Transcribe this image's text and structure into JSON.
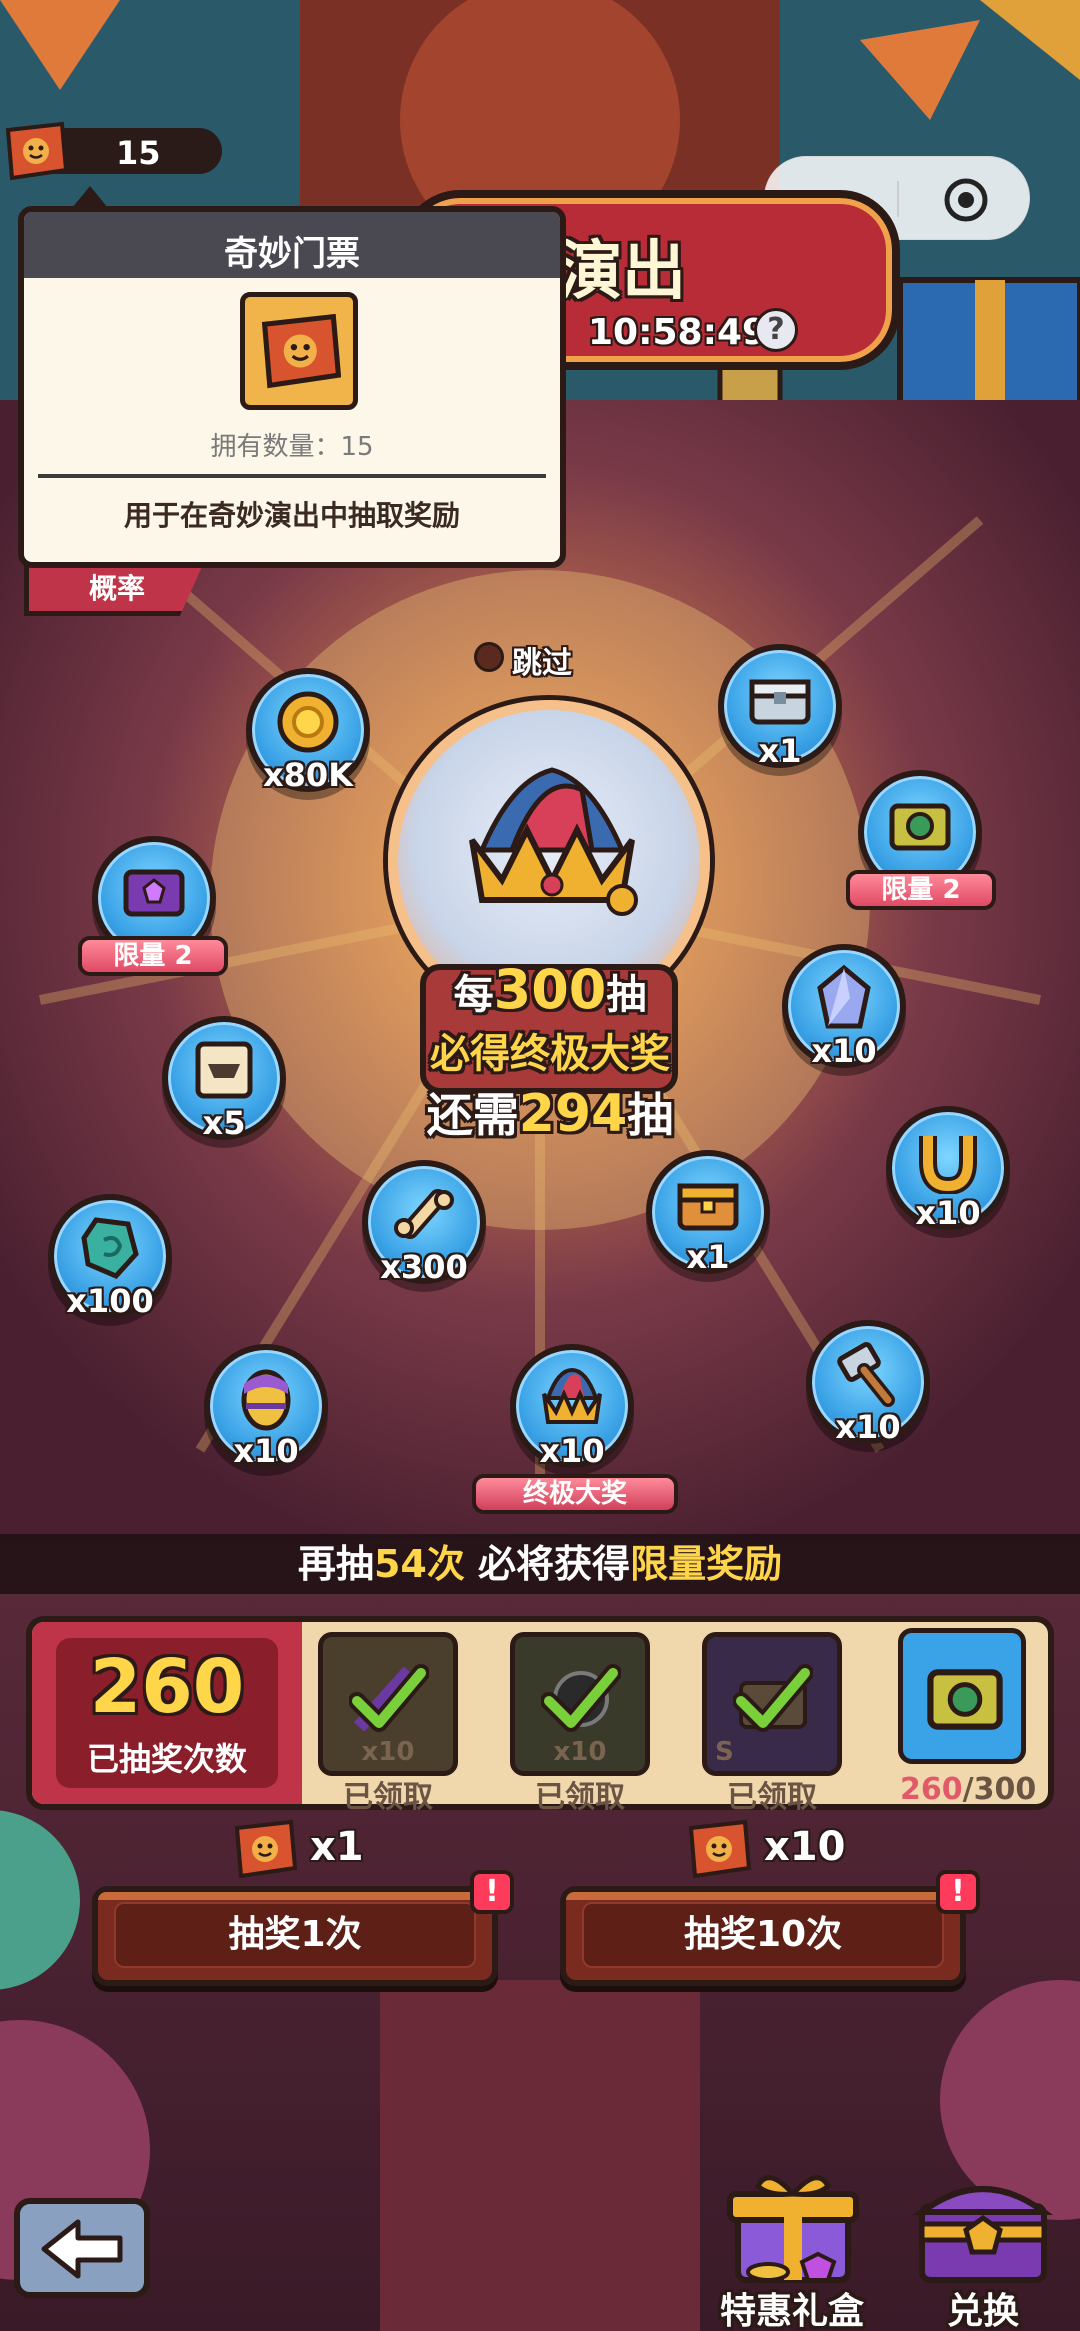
{
  "top_bar": {
    "ticket_count": "15"
  },
  "tooltip": {
    "title": "奇妙门票",
    "owned_label": "拥有数量：",
    "owned_value": "15",
    "description": "用于在奇妙演出中抽取奖励"
  },
  "probability_tab": {
    "label": "概率"
  },
  "banner": {
    "title": "演出",
    "timer": "10:58:49",
    "help_symbol": "?"
  },
  "skip": {
    "label": "跳过"
  },
  "prize_globe": {
    "line1_prefix": "每",
    "line1_number": "300",
    "line1_suffix": "抽",
    "line2": "必得终极大奖",
    "line3_prefix": "还需",
    "line3_number": "294",
    "line3_suffix": "抽"
  },
  "rewards": [
    {
      "icon": "gold-coin-icon",
      "quantity": "x80K"
    },
    {
      "icon": "silver-chest-icon",
      "quantity": "x1"
    },
    {
      "icon": "green-chest-icon",
      "quantity": "",
      "tag": "限量 2"
    },
    {
      "icon": "purple-chest-icon",
      "quantity": "",
      "tag": "限量 2"
    },
    {
      "icon": "crystal-icon",
      "quantity": "x10"
    },
    {
      "icon": "scroll-icon",
      "quantity": "x5"
    },
    {
      "icon": "horseshoe-icon",
      "quantity": "x10"
    },
    {
      "icon": "green-gem-icon",
      "quantity": "x100"
    },
    {
      "icon": "bone-icon",
      "quantity": "x300"
    },
    {
      "icon": "gold-chest-icon",
      "quantity": "x1"
    },
    {
      "icon": "egg-icon",
      "quantity": "x10"
    },
    {
      "icon": "jester-crown-icon",
      "quantity": "x10"
    },
    {
      "icon": "hammer-icon",
      "quantity": "x10"
    }
  ],
  "ultimate_label": "终极大奖",
  "limited_notice": {
    "prefix": "再抽",
    "count": "54次",
    "middle": " 必将获得",
    "highlight": "限量奖励"
  },
  "progress": {
    "draw_count": "260",
    "draw_count_label": "已抽奖次数",
    "milestones": [
      {
        "icon": "sword-icon",
        "qty": "x10",
        "status": "已领取"
      },
      {
        "icon": "orb-icon",
        "qty": "x10",
        "status": "已领取"
      },
      {
        "icon": "dark-chest-icon",
        "qty": "S",
        "status": "已领取"
      }
    ],
    "next_current": "260",
    "next_total": "/300"
  },
  "draw_single": {
    "cost": "x1",
    "label": "抽奖1次",
    "alert": "!"
  },
  "draw_ten": {
    "cost": "x10",
    "label": "抽奖10次",
    "alert": "!"
  },
  "bottom": {
    "gift_label": "特惠礼盒",
    "exchange_label": "兑换"
  },
  "colors": {
    "accent_gold": "#ffd54a",
    "limited_pink": "#ff7a9a",
    "globe_blue": "#3aa2e6"
  }
}
